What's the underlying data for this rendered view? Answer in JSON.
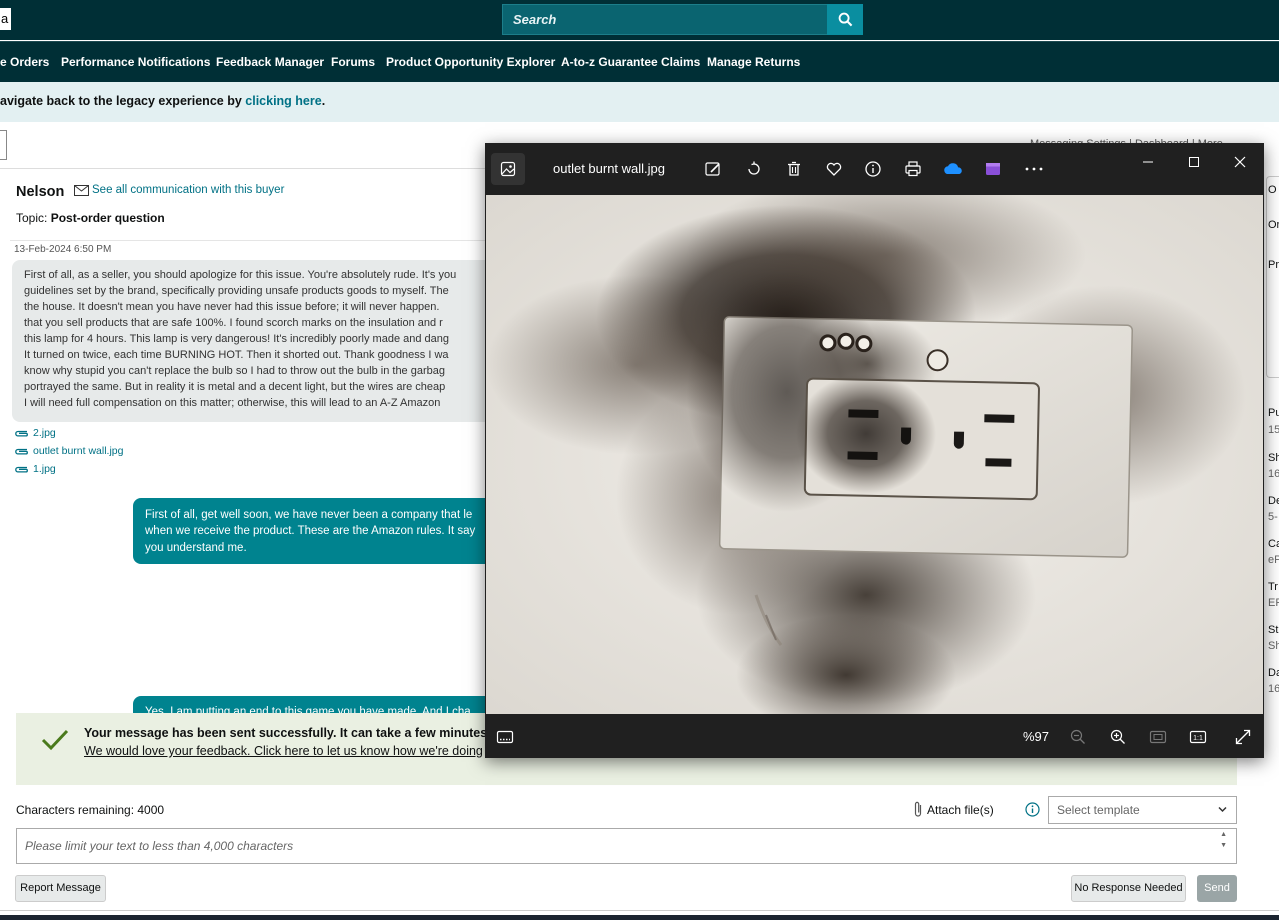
{
  "header": {
    "logo_fragment": "a",
    "search_placeholder": "Search"
  },
  "nav": {
    "items": [
      {
        "label": "e Orders"
      },
      {
        "label": "Performance Notifications"
      },
      {
        "label": "Feedback Manager"
      },
      {
        "label": "Forums"
      },
      {
        "label": "Product Opportunity Explorer"
      },
      {
        "label": "A-to-z Guarantee Claims"
      },
      {
        "label": "Manage Returns"
      }
    ]
  },
  "legacy_banner": {
    "text": "avigate back to the legacy experience by ",
    "link": "clicking here",
    "suffix": "."
  },
  "subbar": {
    "right_text": "Messaging Settings  |  Dashboard  |  More"
  },
  "conversation": {
    "buyer_name": "Nelson",
    "see_all": "See all communication with this buyer",
    "topic_label": "Topic:",
    "topic_value": "Post-order question",
    "buyer_message": {
      "timestamp": "13-Feb-2024 6:50 PM",
      "lines": [
        "First of all, as a seller, you should apologize for this issue. You're absolutely rude. It's you",
        "guidelines set by the brand, specifically providing unsafe products goods to myself. The",
        "the house. It doesn't mean you have never had this issue before; it will never happen.",
        "that you sell products that are safe 100%.  I found scorch marks on the insulation and r",
        "this lamp for 4 hours. This lamp is very dangerous! It's incredibly poorly made and dang",
        " It turned on twice, each time BURNING HOT. Then it shorted out. Thank goodness I wa",
        "know why stupid you can't replace the bulb so I had to throw out the bulb in the garbag",
        "portrayed the same. But in reality it is metal and a decent light, but the wires are cheap",
        "I will need full compensation on this matter; otherwise, this will lead to an A-Z Amazon"
      ],
      "attachments": [
        "2.jpg",
        "outlet burnt wall.jpg",
        "1.jpg"
      ]
    },
    "seller_message": {
      "lines": [
        "First of all, get well soon, we have never been a company that le",
        "when we receive the product. These are the Amazon rules. It say",
        "you understand me."
      ]
    },
    "seller_message_2": {
      "text": "Yes, I am putting an end to this game you have made. And I cha"
    }
  },
  "success": {
    "title": "Your message has been sent successfully. It can take a few minutes t",
    "feedback_link": "We would love your feedback. Click here to let us know how we're doing"
  },
  "composer": {
    "chars_remaining": "Characters remaining: 4000",
    "attach_label": "Attach file(s)",
    "template_placeholder": "Select template",
    "text_placeholder": "Please limit your text to less than 4,000 characters",
    "report_button": "Report Message",
    "no_response_button": "No Response Needed",
    "send_button": "Send"
  },
  "right_panel": {
    "items": [
      {
        "label": "O",
        "value": ""
      },
      {
        "label": "Or",
        "value": ""
      },
      {
        "label": "Pr",
        "value": ""
      },
      {
        "label": "Pu",
        "value": "15"
      },
      {
        "label": "Sh",
        "value": "16"
      },
      {
        "label": "De",
        "value": "5-"
      },
      {
        "label": "Ca",
        "value": "eP"
      },
      {
        "label": "Tr",
        "value": "EP"
      },
      {
        "label": "St",
        "value": "Sh"
      },
      {
        "label": "Da",
        "value": "16"
      }
    ]
  },
  "viewer": {
    "filename": "outlet burnt wall.jpg",
    "zoom": "%97",
    "toolbar_icons": [
      "edit-image-icon",
      "rotate-icon",
      "delete-icon",
      "favorite-icon",
      "info-icon",
      "print-icon",
      "onedrive-icon",
      "clipchamp-icon",
      "more-icon"
    ],
    "colors": {
      "onedrive": "#1e90ff",
      "clipchamp": "#8a4fd8",
      "background": "#202020"
    }
  },
  "colors": {
    "topbar": "#002f36",
    "link": "#007185",
    "teal_bubble": "#00838f",
    "success_bg": "#eaf0e2",
    "success_check": "#4a7a1c"
  }
}
